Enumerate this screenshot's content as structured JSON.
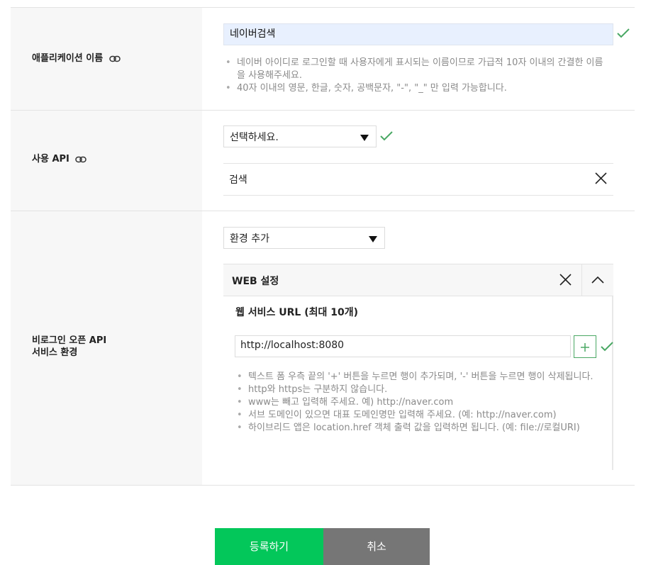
{
  "app_name_row": {
    "label": "애플리케이션 이름",
    "value": "네이버검색",
    "help": [
      "네이버 아이디로 로그인할 때 사용자에게 표시되는 이름이므로 가급적 10자 이내의 간결한 이름을 사용해주세요.",
      "40자 이내의 영문, 한글, 숫자, 공백문자, \"-\", \"_\" 만 입력 가능합니다."
    ]
  },
  "api_row": {
    "label": "사용 API",
    "select_value": "선택하세요.",
    "selected_api": "검색"
  },
  "env_row": {
    "label_line1": "비로그인 오픈 API",
    "label_line2": "서비스 환경",
    "select_value": "환경 추가",
    "panel_title": "WEB 설정",
    "url_title": "웹 서비스 URL (최대 10개)",
    "url_value": "http://localhost:8080",
    "help": [
      "텍스트 폼 우측 끝의 '+' 버튼을 누르면 행이 추가되며, '-' 버튼을 누르면 행이 삭제됩니다.",
      "http와 https는 구분하지 않습니다.",
      "www는 빼고 입력해 주세요. 예) http://naver.com",
      "서브 도메인이 있으면 대표 도메인명만 입력해 주세요. (예: http://naver.com)",
      "하이브리드 앱은 location.href 객체 출력 값을 입력하면 됩니다. (예: file://로컬URI)"
    ]
  },
  "buttons": {
    "submit": "등록하기",
    "cancel": "취소"
  },
  "colors": {
    "accent_green": "#03c75a",
    "check_green": "#4aa864",
    "cancel_gray": "#767676",
    "autofill_blue": "#e8f0fe"
  },
  "icons": [
    "link-icon",
    "check-icon",
    "close-icon",
    "chevron-up-icon",
    "plus-icon",
    "dropdown-arrow-icon"
  ]
}
